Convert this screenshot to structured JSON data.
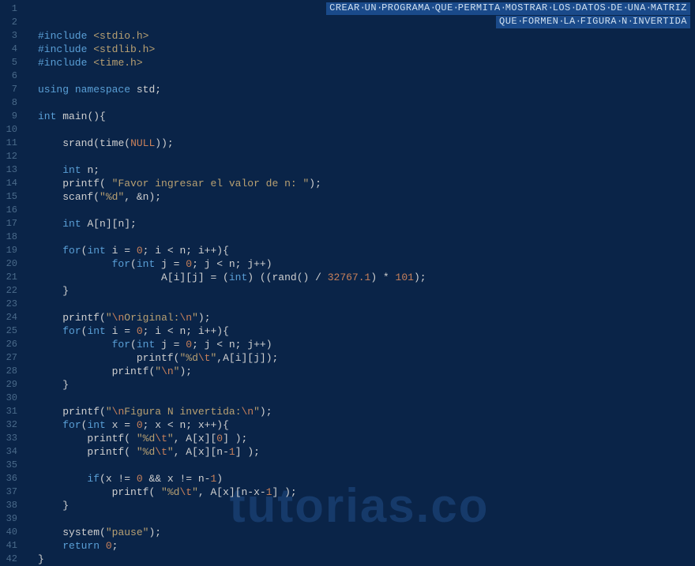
{
  "banner": {
    "line1": "CREAR UN PROGRAMA QUE PERMITA MOSTRAR LOS DATOS DE UNA MATRIZ",
    "line2": "QUE FORMEN LA FIGURA N INVERTIDA"
  },
  "watermark": "tutorias.co",
  "lineCount": 42,
  "code": {
    "l3": {
      "pp": "#include",
      "inc": "<stdio.h>"
    },
    "l4": {
      "pp": "#include",
      "inc": "<stdlib.h>"
    },
    "l5": {
      "pp": "#include",
      "inc": "<time.h>"
    },
    "l7": {
      "kw1": "using",
      "kw2": "namespace",
      "id": "std",
      "semi": ";"
    },
    "l9": {
      "kw": "int",
      "fn": "main",
      "paren": "(){"
    },
    "l11": {
      "fn": "srand",
      "op1": "(",
      "fn2": "time",
      "op2": "(",
      "null": "NULL",
      "op3": "));"
    },
    "l13": {
      "kw": "int",
      "id": "n",
      "semi": ";"
    },
    "l14": {
      "fn": "printf",
      "op1": "( ",
      "str": "\"Favor ingresar el valor de n: \"",
      "op2": ");"
    },
    "l15": {
      "fn": "scanf",
      "op1": "(",
      "str": "\"%d\"",
      "op2": ", &n);"
    },
    "l17": {
      "kw": "int",
      "id": "A[n][n];"
    },
    "l19": {
      "kw": "for",
      "op1": "(",
      "kw2": "int",
      "id1": " i = ",
      "num1": "0",
      "op2": "; i < n; i++){"
    },
    "l20": {
      "kw": "for",
      "op1": "(",
      "kw2": "int",
      "id1": " j = ",
      "num1": "0",
      "op2": "; j < n; j++)"
    },
    "l21": {
      "id": "A[i][j] = (",
      "kw": "int",
      "op1": ") ((",
      "fn": "rand",
      "op2": "() / ",
      "num1": "32767.1",
      "op3": ") * ",
      "num2": "101",
      "op4": ");"
    },
    "l22": {
      "brace": "}"
    },
    "l24": {
      "fn": "printf",
      "op1": "(",
      "q1": "\"",
      "esc1": "\\n",
      "str": "Original:",
      "esc2": "\\n",
      "q2": "\"",
      "op2": ");"
    },
    "l25": {
      "kw": "for",
      "op1": "(",
      "kw2": "int",
      "id1": " i = ",
      "num1": "0",
      "op2": "; i < n; i++){"
    },
    "l26": {
      "kw": "for",
      "op1": "(",
      "kw2": "int",
      "id1": " j = ",
      "num1": "0",
      "op2": "; j < n; j++)"
    },
    "l27": {
      "fn": "printf",
      "op1": "(",
      "q1": "\"",
      "str": "%d",
      "esc": "\\t",
      "q2": "\"",
      "op2": ",A[i][j]);"
    },
    "l28": {
      "fn": "printf",
      "op1": "(",
      "q1": "\"",
      "esc": "\\n",
      "q2": "\"",
      "op2": ");"
    },
    "l29": {
      "brace": "}"
    },
    "l31": {
      "fn": "printf",
      "op1": "(",
      "q1": "\"",
      "esc1": "\\n",
      "str": "Figura N invertida:",
      "esc2": "\\n",
      "q2": "\"",
      "op2": ");"
    },
    "l32": {
      "kw": "for",
      "op1": "(",
      "kw2": "int",
      "id1": " x = ",
      "num1": "0",
      "op2": "; x < n; x++){"
    },
    "l33": {
      "fn": "printf",
      "op1": "( ",
      "q1": "\"",
      "str": "%d",
      "esc": "\\t",
      "q2": "\"",
      "op2": ", A[x][",
      "num": "0",
      "op3": "] );"
    },
    "l34": {
      "fn": "printf",
      "op1": "( ",
      "q1": "\"",
      "str": "%d",
      "esc": "\\t",
      "q2": "\"",
      "op2": ", A[x][n-",
      "num": "1",
      "op3": "] );"
    },
    "l36": {
      "kw": "if",
      "op1": "(x != ",
      "num1": "0",
      "op2": " && x != n-",
      "num2": "1",
      "op3": ")"
    },
    "l37": {
      "fn": "printf",
      "op1": "( ",
      "q1": "\"",
      "str": "%d",
      "esc": "\\t",
      "q2": "\"",
      "op2": ", A[x][n-x-",
      "num": "1",
      "op3": "] );"
    },
    "l38": {
      "brace": "}"
    },
    "l40": {
      "fn": "system",
      "op1": "(",
      "str": "\"pause\"",
      "op2": ");"
    },
    "l41": {
      "kw": "return",
      "sp": " ",
      "num": "0",
      "semi": ";"
    },
    "l42": {
      "brace": "}"
    }
  }
}
